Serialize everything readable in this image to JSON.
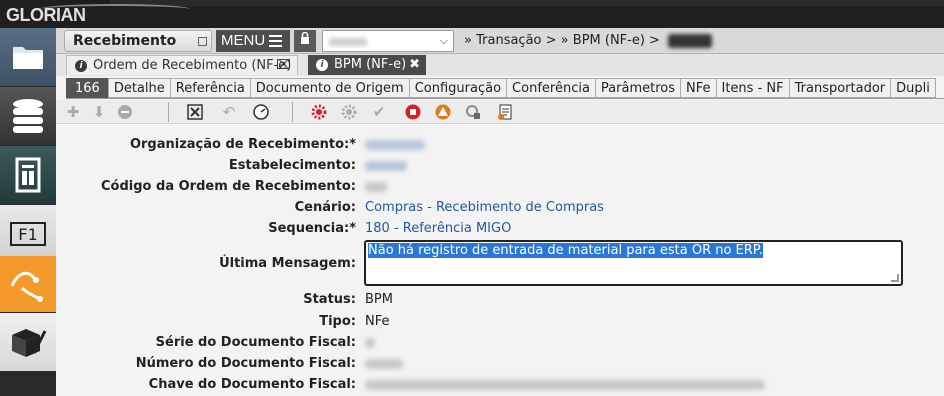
{
  "app": {
    "logo": "GLORIAN"
  },
  "sidebar": {
    "items": [
      {
        "name": "folder"
      },
      {
        "name": "database"
      },
      {
        "name": "document-layout"
      },
      {
        "name": "f1-help"
      },
      {
        "name": "workflow"
      },
      {
        "name": "box-check"
      }
    ]
  },
  "titlebar": {
    "module_title": "Recebimento",
    "menu_label": "MENU",
    "breadcrumb": [
      "Transação >",
      "BPM (NF-e) >"
    ]
  },
  "doc_tabs": [
    {
      "label": "Ordem de Recebimento (NF-e)",
      "close": "⌧"
    },
    {
      "label": "BPM (NF-e)",
      "close": "✖"
    }
  ],
  "sub_tabs": [
    "166",
    "Detalhe",
    "Referência",
    "Documento de Origem",
    "Configuração",
    "Conferência",
    "Parâmetros",
    "NFe",
    "Itens - NF",
    "Transportador",
    "Dupli"
  ],
  "form": {
    "org_label": "Organização de Recebimento:*",
    "estab_label": "Estabelecimento:",
    "codigo_label": "Código da Ordem de Recebimento:",
    "cenario_label": "Cenário:",
    "cenario_value": "Compras - Recebimento de Compras",
    "sequencia_label": "Sequencia:*",
    "sequencia_value": "180 - Referência MIGO",
    "ultima_label": "Última Mensagem:",
    "ultima_value": "Não há registro de entrada de material para esta OR no ERP.",
    "status_label": "Status:",
    "status_value": "BPM",
    "tipo_label": "Tipo:",
    "tipo_value": "NFe",
    "serie_label": "Série do Documento Fiscal:",
    "numero_label": "Número do Documento Fiscal:",
    "chave_label": "Chave do Documento Fiscal:"
  },
  "colors": {
    "accent_orange": "#f39a2a",
    "link_blue": "#2457a0",
    "selection": "#2a78d6"
  }
}
